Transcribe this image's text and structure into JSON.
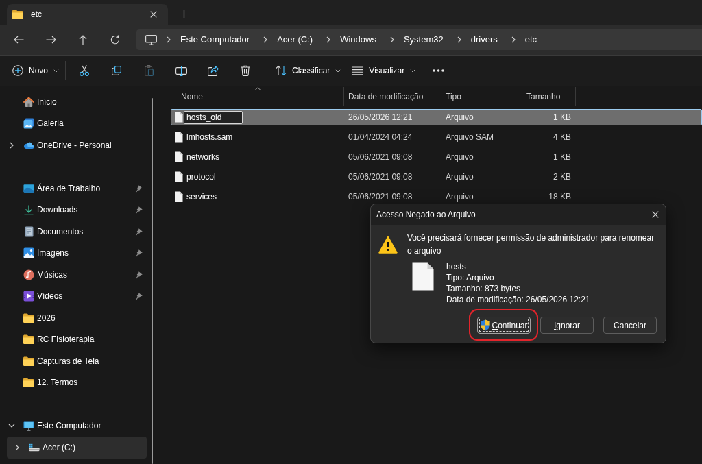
{
  "tabs": [
    {
      "label": "etc",
      "selected": true
    }
  ],
  "address": {
    "breadcrumbs": [
      "Este Computador",
      "Acer (C:)",
      "Windows",
      "System32",
      "drivers",
      "etc"
    ]
  },
  "toolbar": {
    "groups": [
      {
        "items": [
          {
            "kind": "new",
            "label": "Novo",
            "dropdown": true,
            "disabled": false
          }
        ]
      },
      {
        "items": [
          {
            "kind": "cut",
            "dropdown": false,
            "disabled": false
          },
          {
            "kind": "copy",
            "dropdown": false,
            "disabled": false
          },
          {
            "kind": "paste",
            "dropdown": false,
            "disabled": true
          },
          {
            "kind": "rename",
            "dropdown": false,
            "disabled": false
          },
          {
            "kind": "share",
            "dropdown": false,
            "disabled": false
          },
          {
            "kind": "delete",
            "dropdown": false,
            "disabled": false
          }
        ]
      },
      {
        "items": [
          {
            "kind": "sort",
            "label": "Classificar",
            "dropdown": true,
            "disabled": false
          },
          {
            "kind": "view",
            "label": "Visualizar",
            "dropdown": true,
            "disabled": false
          }
        ]
      },
      {
        "items": [
          {
            "kind": "more",
            "dropdown": false,
            "disabled": false
          }
        ]
      }
    ]
  },
  "sidebar": {
    "sections": [
      {
        "items": [
          {
            "label": "Início",
            "kind": "home",
            "pinned": false,
            "selected": false
          },
          {
            "label": "Galeria",
            "kind": "gallery",
            "pinned": false,
            "selected": false
          },
          {
            "label": "OneDrive - Personal",
            "kind": "cloud",
            "pinned": false,
            "selected": false,
            "expanded": false
          }
        ]
      },
      {
        "items": [
          {
            "label": "Área de Trabalho",
            "kind": "desktop",
            "pinned": true,
            "selected": false
          },
          {
            "label": "Downloads",
            "kind": "download",
            "pinned": true,
            "selected": false
          },
          {
            "label": "Documentos",
            "kind": "document",
            "pinned": true,
            "selected": false
          },
          {
            "label": "Imagens",
            "kind": "pictures",
            "pinned": true,
            "selected": false
          },
          {
            "label": "Músicas",
            "kind": "music",
            "pinned": true,
            "selected": false
          },
          {
            "label": "Vídeos",
            "kind": "video",
            "pinned": true,
            "selected": false
          },
          {
            "label": "2026",
            "kind": "folder",
            "pinned": false,
            "selected": false
          },
          {
            "label": "RC FIsioterapia",
            "kind": "folder",
            "pinned": false,
            "selected": false
          },
          {
            "label": "Capturas de Tela",
            "kind": "folder",
            "pinned": false,
            "selected": false
          },
          {
            "label": "12. Termos",
            "kind": "folder",
            "pinned": false,
            "selected": false
          }
        ]
      },
      {
        "items": [
          {
            "label": "Este Computador",
            "kind": "computer",
            "pinned": false,
            "selected": false,
            "expanded": true,
            "children": [
              {
                "label": "Acer (C:)",
                "kind": "drive",
                "pinned": false,
                "selected": true,
                "expanded": false
              }
            ]
          }
        ]
      }
    ]
  },
  "file_list": {
    "columns": [
      {
        "label": "Nome",
        "sorted": true
      },
      {
        "label": "Data de modificação",
        "sorted": false
      },
      {
        "label": "Tipo",
        "sorted": false
      },
      {
        "label": "Tamanho",
        "sorted": false
      }
    ],
    "rows": [
      {
        "name": "hosts_old",
        "modified": "26/05/2026 12:21",
        "type": "Arquivo",
        "size": "1 KB",
        "selected": true,
        "renaming": true
      },
      {
        "name": "lmhosts.sam",
        "modified": "01/04/2024 04:24",
        "type": "Arquivo SAM",
        "size": "4 KB",
        "selected": false,
        "renaming": false
      },
      {
        "name": "networks",
        "modified": "05/06/2021 09:08",
        "type": "Arquivo",
        "size": "1 KB",
        "selected": false,
        "renaming": false
      },
      {
        "name": "protocol",
        "modified": "05/06/2021 09:08",
        "type": "Arquivo",
        "size": "2 KB",
        "selected": false,
        "renaming": false
      },
      {
        "name": "services",
        "modified": "05/06/2021 09:08",
        "type": "Arquivo",
        "size": "18 KB",
        "selected": false,
        "renaming": false
      }
    ]
  },
  "dialog": {
    "title": "Acesso Negado ao Arquivo",
    "message": "Você precisará fornecer permissão de administrador para renomear o arquivo",
    "file": {
      "name": "hosts",
      "details": [
        "Tipo: Arquivo",
        "Tamanho: 873 bytes",
        "Data de modificação: 26/05/2026 12:21"
      ]
    },
    "buttons": [
      {
        "label": "Continuar",
        "shield": true,
        "focused": true,
        "mnemonic": true,
        "annotated": true
      },
      {
        "label": "Ignorar",
        "shield": false,
        "focused": false,
        "mnemonic": true,
        "annotated": false
      },
      {
        "label": "Cancelar",
        "shield": false,
        "focused": false,
        "mnemonic": false,
        "annotated": false
      }
    ]
  }
}
